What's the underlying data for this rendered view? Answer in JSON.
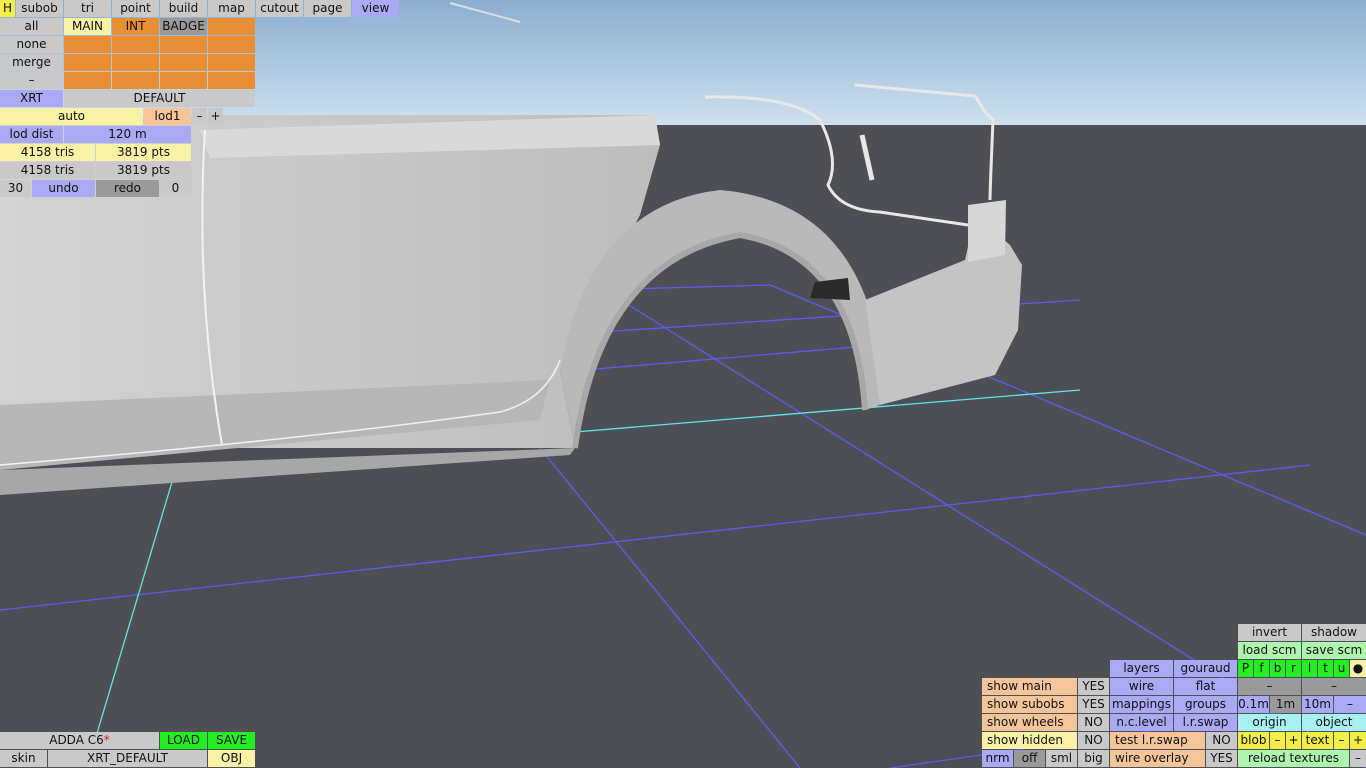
{
  "menu": [
    {
      "label": "H",
      "c": "hy"
    },
    {
      "label": "subob",
      "c": "g"
    },
    {
      "label": "tri",
      "c": "g"
    },
    {
      "label": "point",
      "c": "g"
    },
    {
      "label": "build",
      "c": "g"
    },
    {
      "label": "map",
      "c": "g"
    },
    {
      "label": "cutout",
      "c": "g"
    },
    {
      "label": "page",
      "c": "g"
    },
    {
      "label": "view",
      "c": "v"
    }
  ],
  "subobj": {
    "all_label": "all",
    "none_label": "none",
    "merge_label": "merge",
    "dash_label": "–",
    "main_label": "MAIN",
    "int_label": "INT",
    "badge_label": "BADGE"
  },
  "variant": {
    "xrt": "XRT",
    "default": "DEFAULT"
  },
  "lod": {
    "mode": "auto",
    "name": "lod1",
    "minus": "–",
    "plus": "+",
    "dist_label": "lod dist",
    "dist_value": "120 m"
  },
  "stats": {
    "tris_a": "4158 tris",
    "pts_a": "3819 pts",
    "tris_b": "4158 tris",
    "pts_b": "3819 pts"
  },
  "history": {
    "count": "30",
    "undo": "undo",
    "redo": "redo",
    "redo_count": "0"
  },
  "file": {
    "name": "ADDA C6",
    "modified_mark": "*",
    "load": "LOAD",
    "save": "SAVE",
    "skin_label": "skin",
    "skin_value": "XRT_DEFAULT",
    "format": "OBJ"
  },
  "view_panel": {
    "invert": "invert",
    "shadow": "shadow",
    "load_scm": "load scm",
    "save_scm": "save scm",
    "pfbrltu": [
      "P",
      "f",
      "b",
      "r",
      "l",
      "t",
      "u"
    ],
    "dot": "●",
    "layers": "layers",
    "gouraud": "gouraud",
    "wire": "wire",
    "flat": "flat",
    "dash": "–",
    "mappings": "mappings",
    "groups": "groups",
    "scale_a": "0.1m",
    "scale_b": "1m",
    "scale_c": "10m",
    "nclevel": "n.c.level",
    "lrswap": "l.r.swap",
    "origin": "origin",
    "object": "object",
    "test_lrswap": "test l.r.swap",
    "test_lrswap_value": "NO",
    "blob": "blob",
    "text": "text",
    "plus": "+",
    "minus": "–",
    "wire_overlay": "wire overlay",
    "wire_overlay_value": "YES",
    "reload_textures": "reload textures",
    "nrm": "nrm",
    "off": "off",
    "sml": "sml",
    "big": "big"
  },
  "show": {
    "main": "show main",
    "main_value": "YES",
    "subobs": "show subobs",
    "subobs_value": "YES",
    "wheels": "show wheels",
    "wheels_value": "NO",
    "hidden": "show hidden",
    "hidden_value": "NO"
  },
  "colors": {
    "sky_top": "#8aaed0",
    "sky_bottom": "#cfe0ee",
    "ground": "#4d4f55",
    "grid": "#5b5bf0",
    "grid_axis": "#5fe6e6",
    "body": "#c8c8c8"
  }
}
